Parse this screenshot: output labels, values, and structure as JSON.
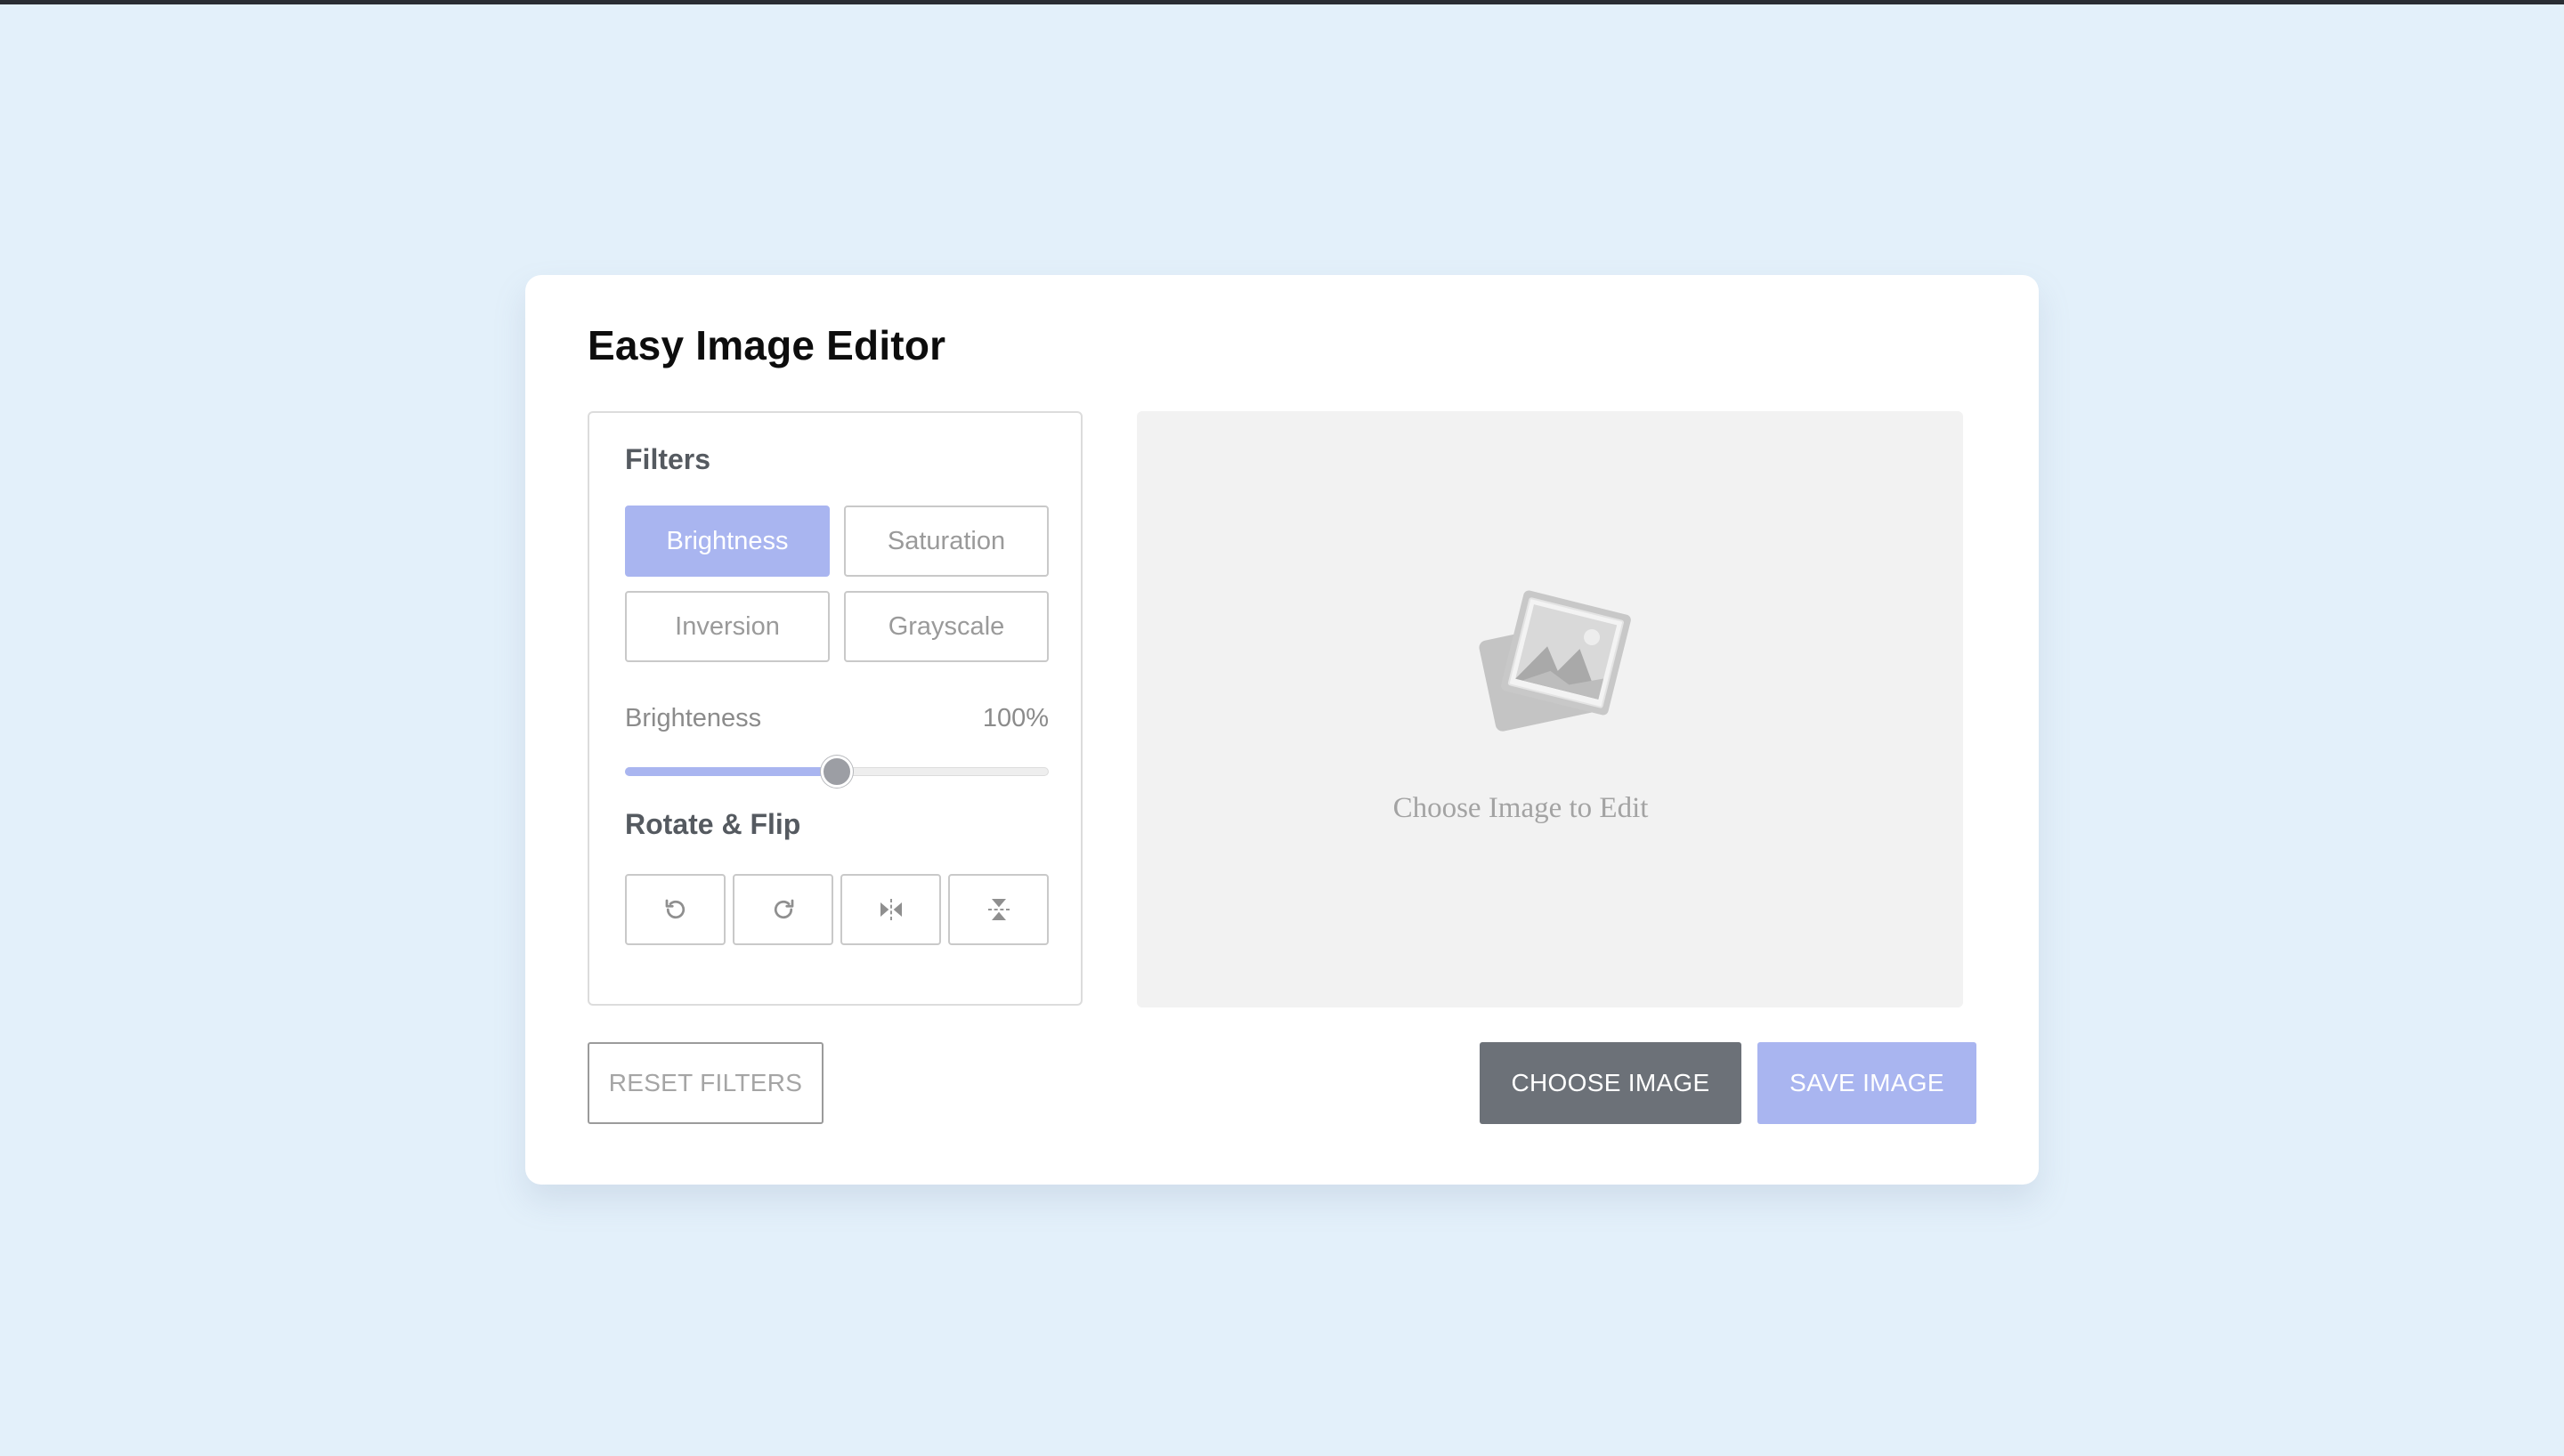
{
  "app": {
    "title": "Easy Image Editor"
  },
  "filters": {
    "heading": "Filters",
    "options": [
      {
        "label": "Brightness",
        "active": true
      },
      {
        "label": "Saturation",
        "active": false
      },
      {
        "label": "Inversion",
        "active": false
      },
      {
        "label": "Grayscale",
        "active": false
      }
    ],
    "slider": {
      "name": "Brighteness",
      "value_text": "100%",
      "value_fraction": 0.5
    }
  },
  "rotate_flip": {
    "heading": "Rotate & Flip",
    "buttons": [
      {
        "icon": "rotate-left-icon"
      },
      {
        "icon": "rotate-right-icon"
      },
      {
        "icon": "flip-horizontal-icon"
      },
      {
        "icon": "flip-vertical-icon"
      }
    ]
  },
  "preview": {
    "placeholder_icon": "image-placeholder-icon",
    "placeholder_text": "Choose Image to Edit"
  },
  "actions": {
    "reset_label": "RESET FILTERS",
    "choose_label": "CHOOSE IMAGE",
    "save_label": "SAVE IMAGE"
  },
  "colors": {
    "background": "#e3f0fa",
    "accent": "#a9b5f0",
    "choose_button": "#6c7178",
    "top_bar": "#2a2d33"
  }
}
